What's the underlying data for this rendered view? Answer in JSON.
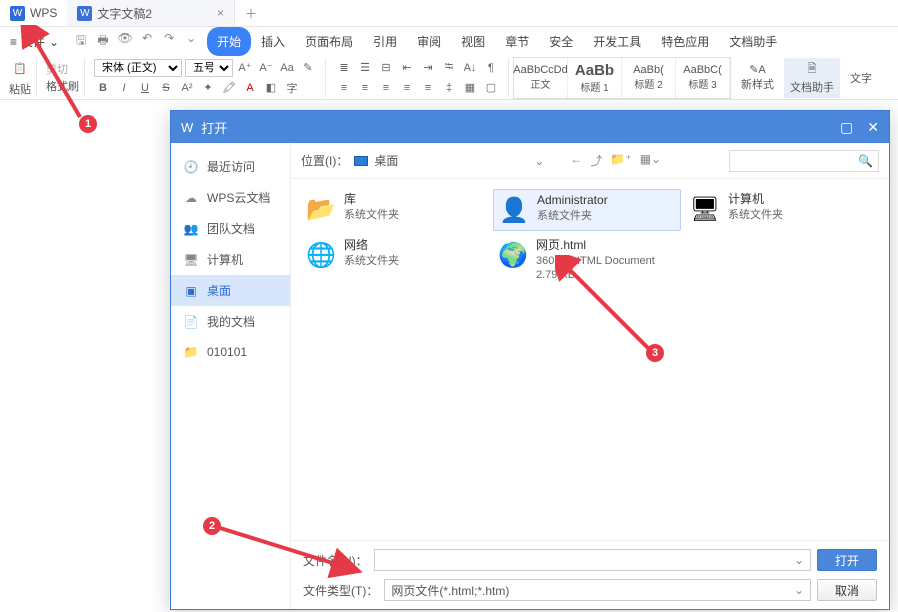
{
  "titlebar": {
    "app": "WPS",
    "doc_tab": "文字文稿2"
  },
  "menubar": {
    "file": "文件",
    "tabs": [
      "开始",
      "插入",
      "页面布局",
      "引用",
      "审阅",
      "视图",
      "章节",
      "安全",
      "开发工具",
      "特色应用",
      "文档助手"
    ]
  },
  "ribbon": {
    "paste": "粘贴",
    "cut": "剪切",
    "fmt_painter": "格式刷",
    "font_name": "宋体 (正文)",
    "font_size": "五号",
    "styles": [
      {
        "preview": "AaBbCcDd",
        "label": "正文"
      },
      {
        "preview": "AaBb",
        "label": "标题 1",
        "big": true
      },
      {
        "preview": "AaBb(",
        "label": "标题 2"
      },
      {
        "preview": "AaBbC(",
        "label": "标题 3"
      }
    ],
    "new_style": "新样式",
    "doc_helper": "文档助手",
    "char": "文字"
  },
  "dialog": {
    "title": "打开",
    "sidebar": [
      {
        "icon": "🕘",
        "label": "最近访问"
      },
      {
        "icon": "☁",
        "label": "WPS云文档"
      },
      {
        "icon": "👥",
        "label": "团队文档"
      },
      {
        "icon": "🖥",
        "label": "计算机"
      },
      {
        "icon": "▣",
        "label": "桌面",
        "active": true
      },
      {
        "icon": "📄",
        "label": "我的文档"
      },
      {
        "icon": "📁",
        "label": "010101"
      }
    ],
    "location_label": "位置(I)：",
    "location_value": "桌面",
    "items": [
      {
        "icon": "📂",
        "name": "库",
        "sub": "系统文件夹"
      },
      {
        "icon": "👤",
        "name": "Administrator",
        "sub": "系统文件夹",
        "selected": true
      },
      {
        "icon": "🖥",
        "name": "计算机",
        "sub": "系统文件夹"
      },
      {
        "icon": "🌐",
        "name": "网络",
        "sub": "系统文件夹"
      },
      {
        "icon": "🌍",
        "name": "网页.html",
        "sub": "360 se HTML Document",
        "sub2": "2.79 KB"
      }
    ],
    "file_name_label": "文件名(N)：",
    "file_name_value": "",
    "file_type_label": "文件类型(T)：",
    "file_type_value": "网页文件(*.html;*.htm)",
    "open_btn": "打开",
    "cancel_btn": "取消"
  },
  "annotations": {
    "a1": "1",
    "a2": "2",
    "a3": "3"
  }
}
